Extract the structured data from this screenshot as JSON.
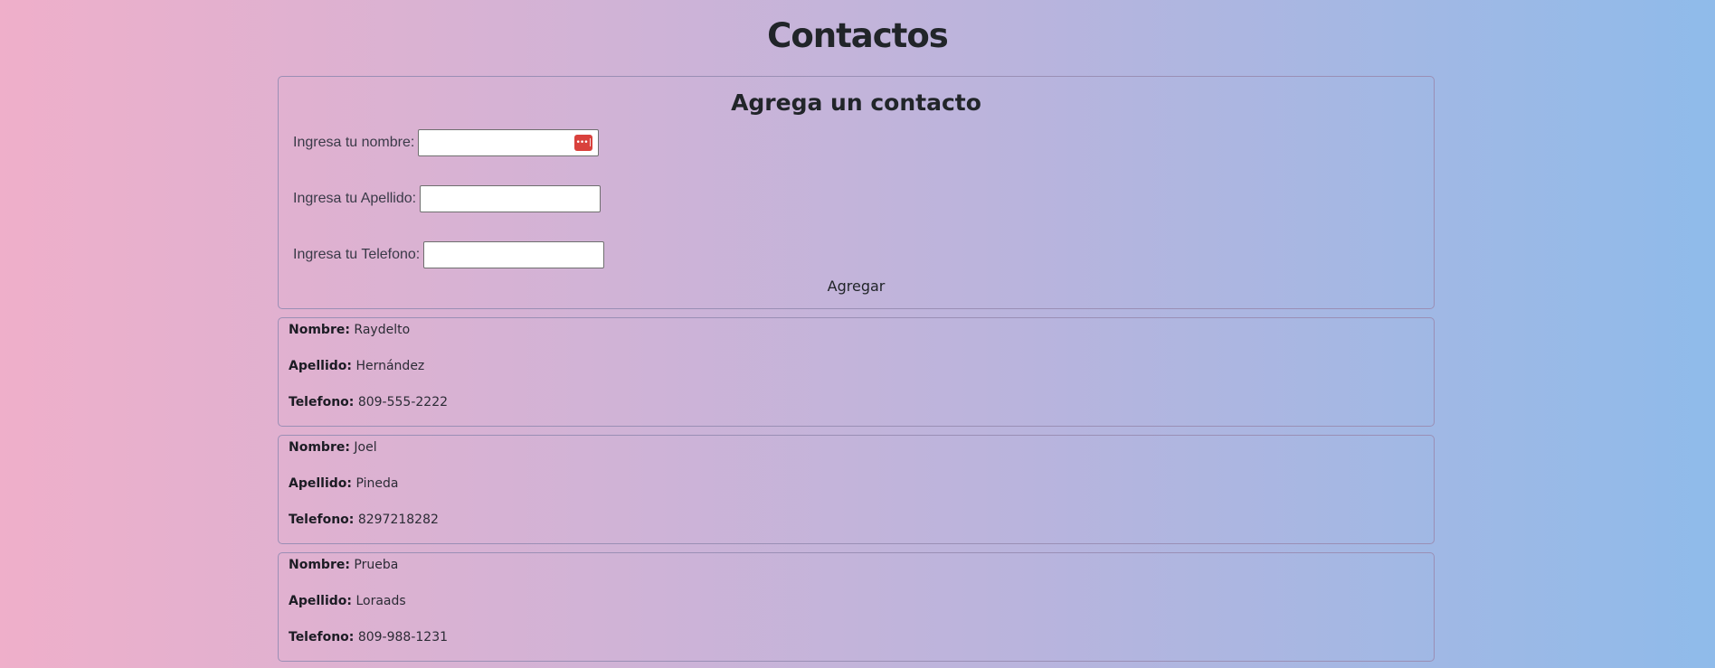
{
  "page": {
    "title": "Contactos"
  },
  "form": {
    "title": "Agrega un contacto",
    "fields": [
      {
        "label": "Ingresa tu nombre:",
        "value": "",
        "placeholder": ""
      },
      {
        "label": "Ingresa tu Apellido:",
        "value": "",
        "placeholder": ""
      },
      {
        "label": "Ingresa tu Telefono:",
        "value": "",
        "placeholder": ""
      }
    ],
    "submit_label": "Agregar",
    "password_manager_icon": "password-manager-icon"
  },
  "contacts": {
    "labels": {
      "nombre": "Nombre:",
      "apellido": "Apellido:",
      "telefono": "Telefono:"
    },
    "items": [
      {
        "nombre": "Raydelto",
        "apellido": "Hernández",
        "telefono": "809-555-2222"
      },
      {
        "nombre": "Joel",
        "apellido": "Pineda",
        "telefono": "8297218282"
      },
      {
        "nombre": "Prueba",
        "apellido": "Loraads",
        "telefono": "809-988-1231"
      }
    ]
  },
  "colors": {
    "gradient_left": "#efafca",
    "gradient_right": "#8fbbea",
    "border": "#9a8fb5",
    "icon_red": "#d9413c"
  }
}
